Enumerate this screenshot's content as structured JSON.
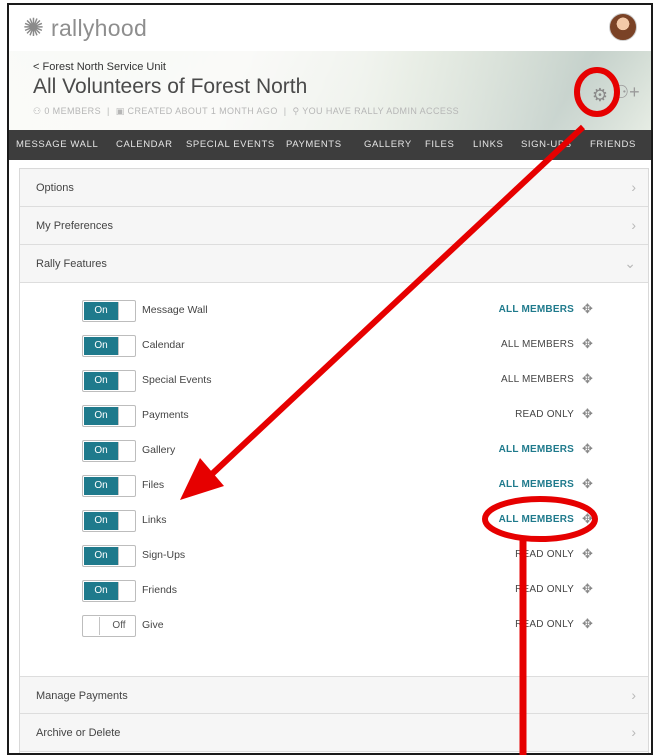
{
  "app": {
    "logo_text": "rallyhood"
  },
  "header": {
    "breadcrumb": "< Forest North Service Unit",
    "title": "All Volunteers of Forest North",
    "meta": [
      "⚇ 0 MEMBERS",
      "|",
      "▣ CREATED ABOUT 1 MONTH AGO",
      "|",
      "⚲ YOU HAVE RALLY ADMIN ACCESS"
    ]
  },
  "nav": [
    "MESSAGE WALL",
    "CALENDAR",
    "SPECIAL EVENTS",
    "PAYMENTS",
    "GALLERY",
    "FILES",
    "LINKS",
    "SIGN-UPS",
    "FRIENDS"
  ],
  "sections": {
    "options": "Options",
    "preferences": "My Preferences",
    "features": "Rally Features",
    "manage_payments": "Manage Payments",
    "archive": "Archive or Delete"
  },
  "toggle_labels": {
    "on": "On",
    "off": "Off"
  },
  "features": [
    {
      "name": "Message Wall",
      "state": "on",
      "access": "ALL MEMBERS",
      "style": "link"
    },
    {
      "name": "Calendar",
      "state": "on",
      "access": "ALL MEMBERS",
      "style": "plain"
    },
    {
      "name": "Special Events",
      "state": "on",
      "access": "ALL MEMBERS",
      "style": "plain"
    },
    {
      "name": "Payments",
      "state": "on",
      "access": "READ ONLY",
      "style": "plain"
    },
    {
      "name": "Gallery",
      "state": "on",
      "access": "ALL MEMBERS",
      "style": "link"
    },
    {
      "name": "Files",
      "state": "on",
      "access": "ALL MEMBERS",
      "style": "link"
    },
    {
      "name": "Links",
      "state": "on",
      "access": "ALL MEMBERS",
      "style": "link"
    },
    {
      "name": "Sign-Ups",
      "state": "on",
      "access": "READ ONLY",
      "style": "plain"
    },
    {
      "name": "Friends",
      "state": "on",
      "access": "READ ONLY",
      "style": "plain"
    },
    {
      "name": "Give",
      "state": "off",
      "access": "READ ONLY",
      "style": "plain"
    }
  ],
  "colors": {
    "accent": "#1f7a8c",
    "annotation": "#e60000",
    "nav_bg": "#3d3d3d"
  },
  "icons": {
    "gear": "gear-icon",
    "add_friend": "add-user-icon",
    "move": "move-handle-icon",
    "chevron": "chevron-right-icon"
  }
}
